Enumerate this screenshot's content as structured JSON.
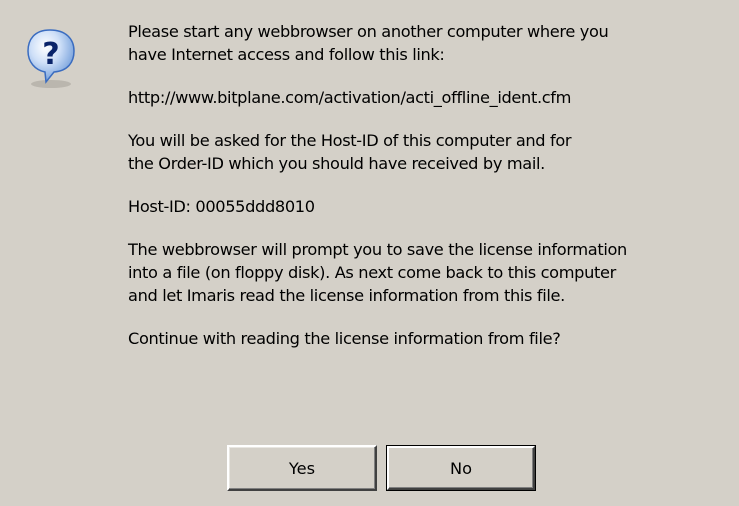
{
  "dialog": {
    "icon": "question-icon",
    "lines": [
      "Please start any webbrowser on another computer where you",
      "have Internet access and follow this link:",
      "http://www.bitplane.com/activation/acti_offline_ident.cfm",
      "You will be asked for the Host-ID of this computer and for",
      "the Order-ID which you should have received by mail.",
      "Host-ID: 00055ddd8010",
      "The webbrowser will prompt you to save the license information",
      "into a file (on floppy disk). As next come back to this computer",
      "and let Imaris read the license information from this file.",
      "Continue with reading the license information from file?"
    ],
    "yes_label": "Yes",
    "no_label": "No"
  },
  "colors": {
    "background": "#d4d0c8",
    "icon_blue": "#1f5fbf",
    "icon_glyph": "#0a246a"
  }
}
